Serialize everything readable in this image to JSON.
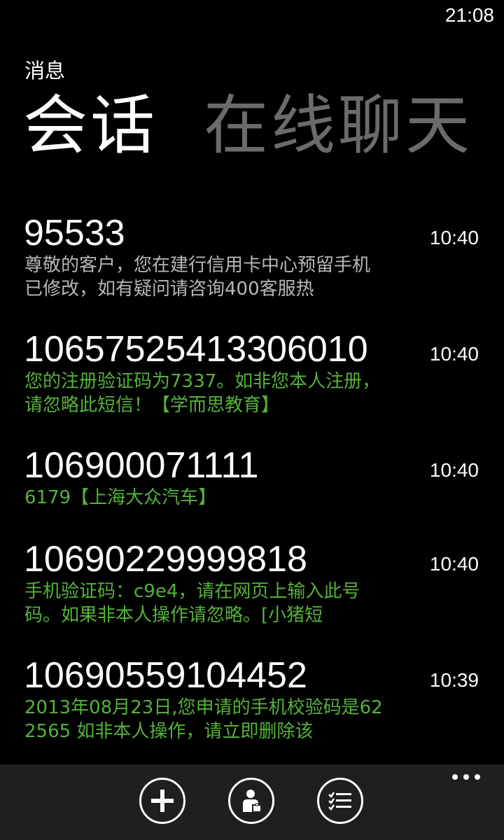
{
  "status_bar": {
    "time": "21:08"
  },
  "app_title": "消息",
  "pivot": {
    "active": "会话",
    "inactive": "在线聊天"
  },
  "messages": [
    {
      "sender": "95533",
      "time": "10:40",
      "preview": "尊敬的客户，您在建行信用卡中心预留手机已修改，如有疑问请咨询400客服热",
      "unread": false
    },
    {
      "sender": "10657525413306010",
      "time": "10:40",
      "preview": "您的注册验证码为7337。如非您本人注册，请忽略此短信！【学而思教育】",
      "unread": true
    },
    {
      "sender": "106900071111",
      "time": "10:40",
      "preview": "6179【上海大众汽车】",
      "unread": true
    },
    {
      "sender": "10690229999818",
      "time": "10:40",
      "preview": "手机验证码：c9e4，请在网页上输入此号码。如果非本人操作请忽略。[小猪短",
      "unread": true
    },
    {
      "sender": "10690559104452",
      "time": "10:39",
      "preview": "2013年08月23日,您申请的手机校验码是622565 如非本人操作，请立即删除该",
      "unread": true
    }
  ],
  "app_bar": {
    "buttons": [
      {
        "icon": "add-icon"
      },
      {
        "icon": "contact-icon"
      },
      {
        "icon": "select-list-icon"
      }
    ],
    "more": "more-icon"
  },
  "colors": {
    "background": "#000000",
    "unread_preview": "#55b23a",
    "read_preview": "#b7b7b7",
    "inactive_pivot": "#6b6b6b",
    "app_bar": "#1f1f1f"
  }
}
